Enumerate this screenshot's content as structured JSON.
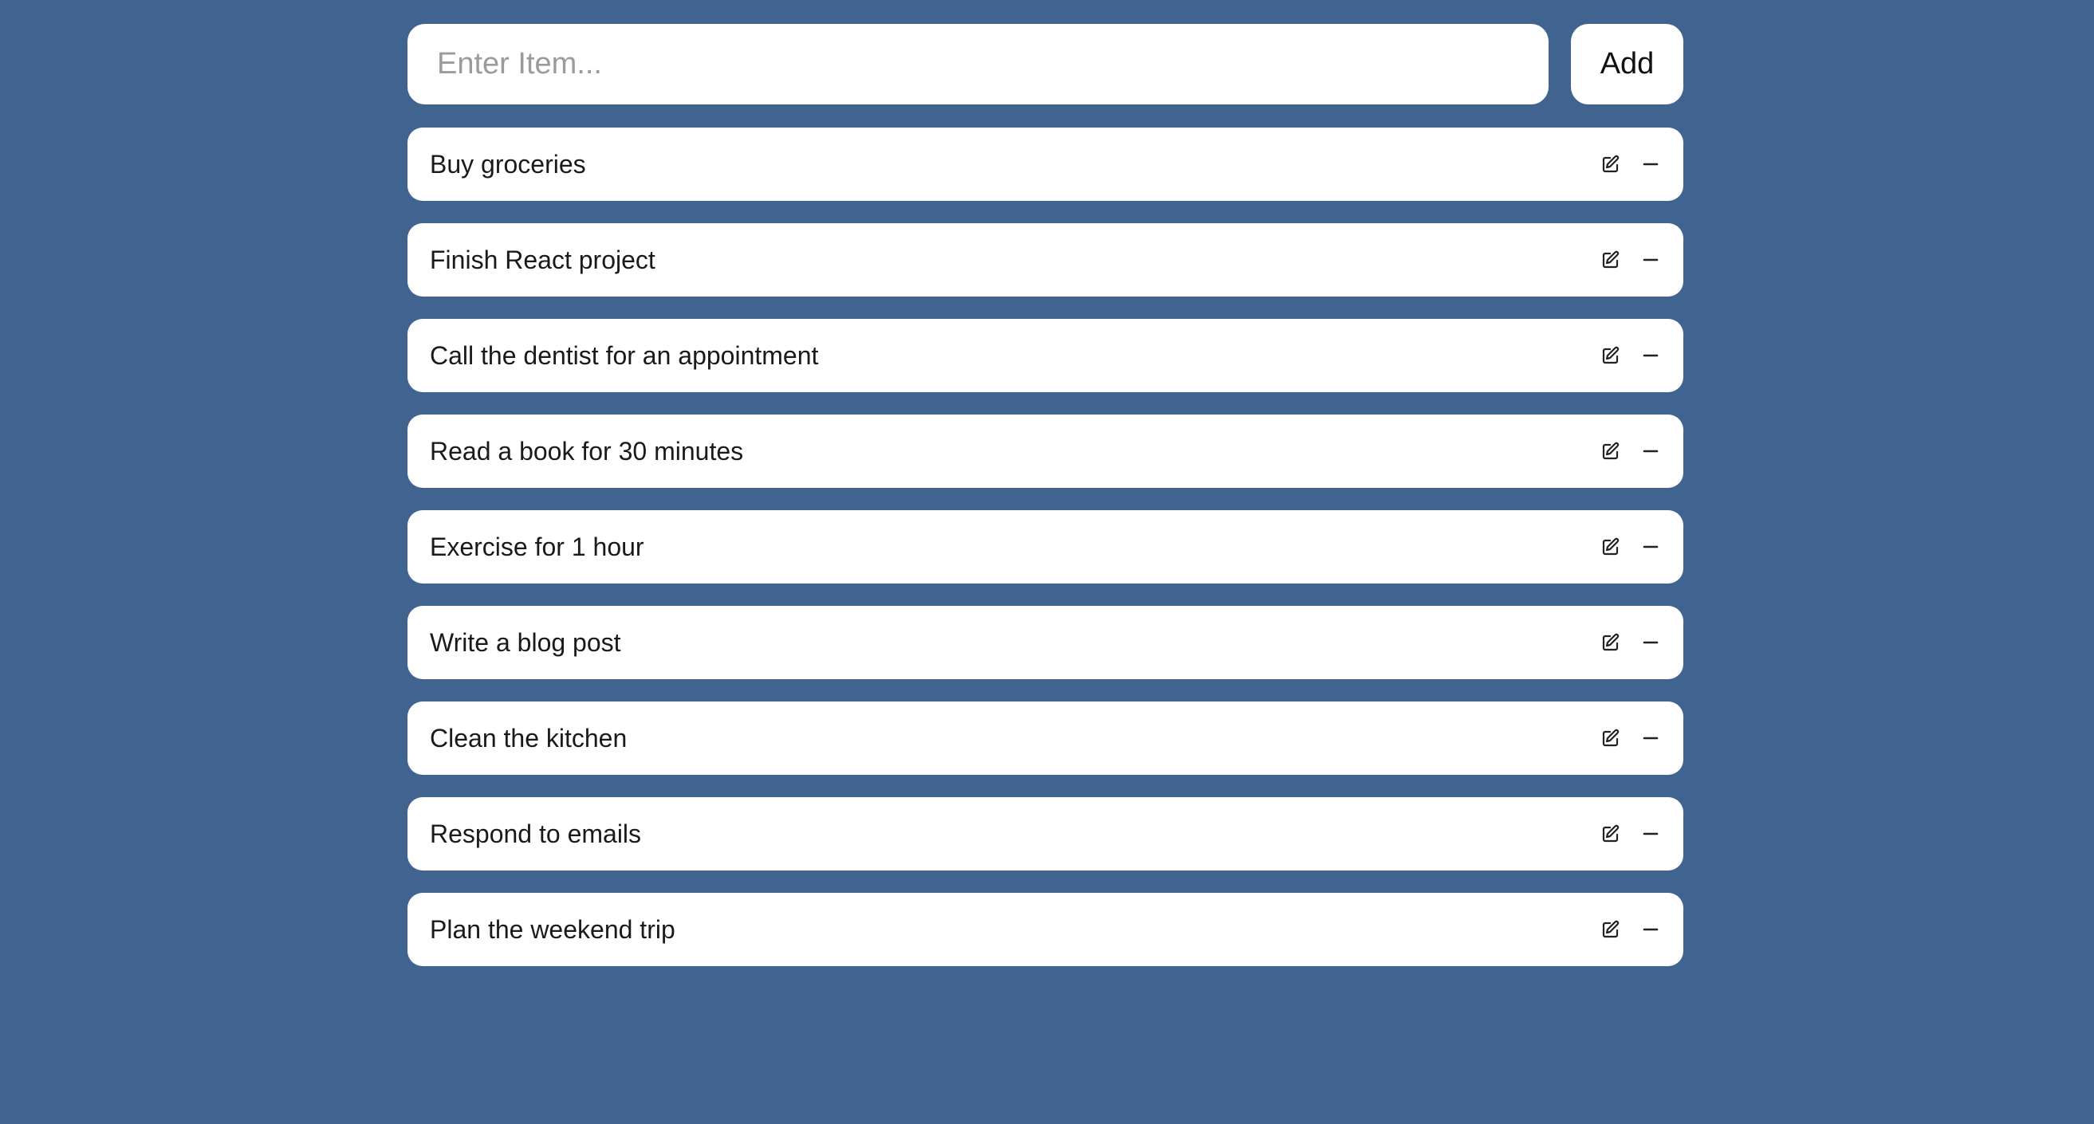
{
  "entry": {
    "placeholder": "Enter Item...",
    "value": "",
    "add_label": "Add"
  },
  "items": [
    {
      "label": "Buy groceries",
      "edit_icon": "edit-icon",
      "remove_icon": "minus-icon"
    },
    {
      "label": "Finish React project",
      "edit_icon": "edit-icon",
      "remove_icon": "minus-icon"
    },
    {
      "label": "Call the dentist for an appointment",
      "edit_icon": "edit-icon",
      "remove_icon": "minus-icon"
    },
    {
      "label": "Read a book for 30 minutes",
      "edit_icon": "edit-icon",
      "remove_icon": "minus-icon"
    },
    {
      "label": "Exercise for 1 hour",
      "edit_icon": "edit-icon",
      "remove_icon": "minus-icon"
    },
    {
      "label": "Write a blog post",
      "edit_icon": "edit-icon",
      "remove_icon": "minus-icon"
    },
    {
      "label": "Clean the kitchen",
      "edit_icon": "edit-icon",
      "remove_icon": "minus-icon"
    },
    {
      "label": "Respond to emails",
      "edit_icon": "edit-icon",
      "remove_icon": "minus-icon"
    },
    {
      "label": "Plan the weekend trip",
      "edit_icon": "edit-icon",
      "remove_icon": "minus-icon"
    }
  ],
  "colors": {
    "background": "#416390",
    "card": "#ffffff",
    "text": "#1a1a1a",
    "placeholder": "#9b9b9b"
  }
}
